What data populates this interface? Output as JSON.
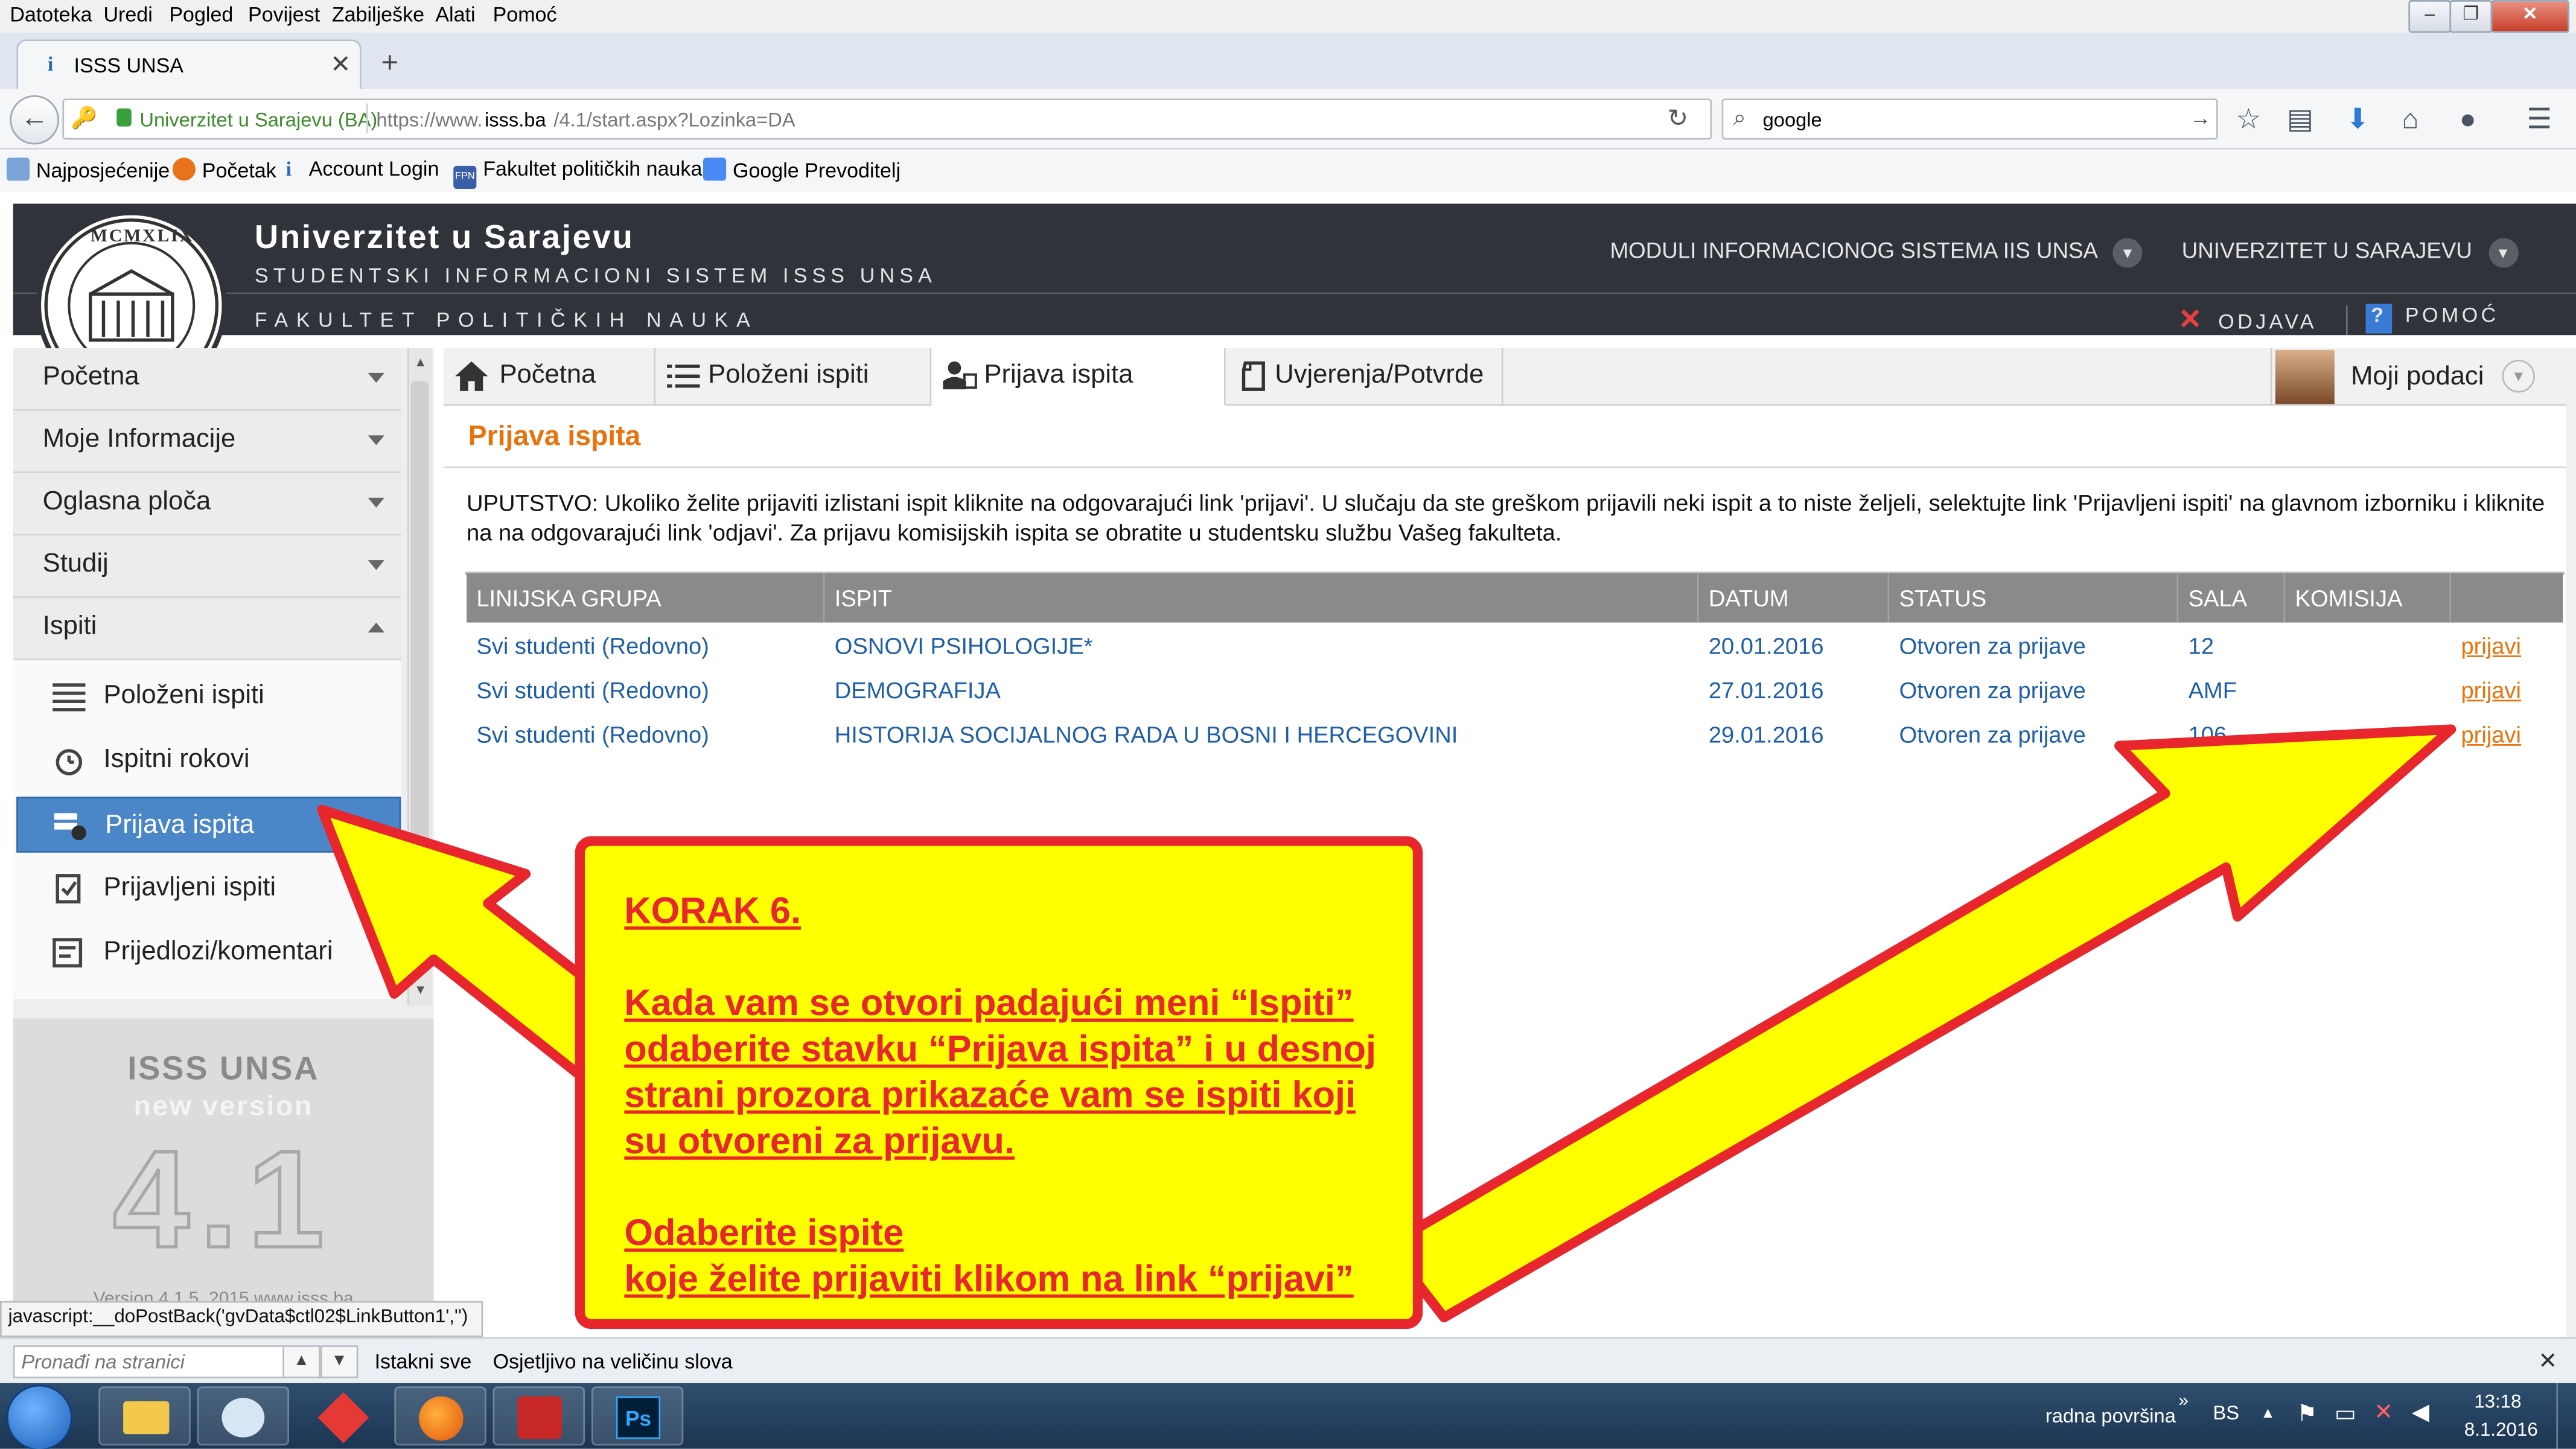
{
  "browser": {
    "menu": [
      "Datoteka",
      "Uredi",
      "Pogled",
      "Povijest",
      "Zabilješke",
      "Alati",
      "Pomoć"
    ],
    "tab_title": "ISSS UNSA",
    "url_identity": "Univerzitet u Sarajevu (BA)",
    "url_prefix": "https://www.",
    "url_host": "isss.ba",
    "url_path": "/4.1/start.aspx?Lozinka=DA",
    "search_value": "google",
    "bookmarks": [
      "Najposjećenije",
      "Početak",
      "Account Login",
      "Fakultet političkih nauka",
      "Google Prevoditelj"
    ],
    "bookmark_badge": "FPN",
    "status_text": "javascript:__doPostBack('gvData$ctl02$LinkButton1','')",
    "find_placeholder": "Pronađi na stranici",
    "find_highlight_all": "Istakni sve",
    "find_match_case": "Osjetljivo na veličinu slova"
  },
  "site": {
    "university": "Univerzitet u Sarajevu",
    "subtitle": "STUDENTSKI INFORMACIONI SISTEM ISSS UNSA",
    "faculty": "FAKULTET POLITIČKIH NAUKA",
    "seal_text": "MCMXLIX",
    "modules_label": "MODULI INFORMACIONOG SISTEMA IIS UNSA",
    "univ_menu_label": "UNIVERZITET U SARAJEVU",
    "logout_label": "ODJAVA",
    "help_label": "POMOĆ"
  },
  "left_nav": {
    "items": [
      "Početna",
      "Moje Informacije",
      "Oglasna ploča",
      "Studij",
      "Ispiti"
    ],
    "sub_items": [
      "Položeni ispiti",
      "Ispitni rokovi",
      "Prijava ispita",
      "Prijavljeni ispiti",
      "Prijedlozi/komentari"
    ],
    "active_sub": "Prijava ispita",
    "brand_line1": "ISSS UNSA",
    "brand_line2": "new version",
    "brand_version": "4.1",
    "brand_footer": "Version 4.1.5, 2015 www.isss.ba"
  },
  "main": {
    "tabs": [
      "Početna",
      "Položeni ispiti",
      "Prijava ispita",
      "Uvjerenja/Potvrde"
    ],
    "profile_label": "Moji podaci",
    "heading": "Prijava ispita",
    "instructions": "UPUTSTVO: Ukoliko želite prijaviti izlistani ispit kliknite na odgovarajući link 'prijavi'. U slučaju da ste greškom prijavili neki ispit a to niste željeli, selektujte link 'Prijavljeni ispiti' na glavnom izborniku i kliknite na na odgovarajući link 'odjavi'. Za prijavu komisijskih ispita se obratite u studentsku službu Vašeg fakulteta.",
    "table": {
      "headers": [
        "LINIJSKA GRUPA",
        "ISPIT",
        "DATUM",
        "STATUS",
        "SALA",
        "KOMISIJA",
        ""
      ],
      "rows": [
        {
          "group": "Svi studenti (Redovno)",
          "exam": "OSNOVI PSIHOLOGIJE*",
          "date": "20.01.2016",
          "status": "Otvoren za prijave",
          "room": "12",
          "committee": "",
          "action": "prijavi"
        },
        {
          "group": "Svi studenti (Redovno)",
          "exam": "DEMOGRAFIJA",
          "date": "27.01.2016",
          "status": "Otvoren za prijave",
          "room": "AMF",
          "committee": "",
          "action": "prijavi"
        },
        {
          "group": "Svi studenti (Redovno)",
          "exam": "HISTORIJA SOCIJALNOG RADA U BOSNI I HERCEGOVINI",
          "date": "29.01.2016",
          "status": "Otvoren za prijave",
          "room": "106",
          "committee": "",
          "action": "prijavi"
        }
      ]
    }
  },
  "callout": {
    "lines": [
      "KORAK 6.",
      "Kada vam se otvori padajući meni “Ispiti”",
      "odaberite stavku “Prijava ispita” i u desnoj",
      "strani prozora prikazaće vam se ispiti koji",
      "su otvoreni za prijavu.",
      "Odaberite ispite",
      "koje želite prijaviti klikom na link “prijavi”"
    ]
  },
  "taskbar": {
    "desktop_label": "radna površina",
    "lang": "BS",
    "time": "13:18",
    "date": "8.1.2016",
    "ps_label": "Ps"
  },
  "colors": {
    "accent_orange": "#e8730c",
    "link_blue": "#1e5fa8",
    "header_dark": "#30343a",
    "active_blue": "#4a86c8",
    "callout_yellow": "#ffff00",
    "callout_red": "#e8262d"
  }
}
